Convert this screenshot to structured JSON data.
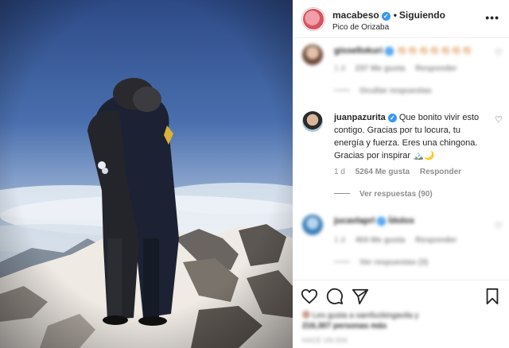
{
  "post": {
    "username": "macabeso",
    "follow_separator": "•",
    "follow_status": "Siguiendo",
    "location": "Pico de Orizaba",
    "more_icon": "ellipsis-icon"
  },
  "comments": [
    {
      "username": "gissellokuri",
      "text": "👏🏻👏🏻👏🏻👏🏻👏🏻👏🏻👏🏻",
      "time": "1 d",
      "likes": "237 Me gusta",
      "reply": "Responder",
      "replies_label": "Ocultar respuestas",
      "blurred": true
    },
    {
      "username": "juanpazurita",
      "text": "Que bonito vivir esto contigo. Gracias por tu locura, tu energía y fuerza. Eres una chingona. Gracias por inspirar 🏔️🌙",
      "time": "1 d",
      "likes": "5264 Me gusta",
      "reply": "Responder",
      "replies_label": "Ver respuestas (90)",
      "blurred": false
    },
    {
      "username": "jucavlaprl",
      "text": "Ídolos",
      "time": "1 d",
      "likes": "404 Me gusta",
      "reply": "Responder",
      "replies_label": "Ver respuestas (3)",
      "blurred": true
    }
  ],
  "actions": {
    "like_icon": "heart-icon",
    "comment_icon": "comment-icon",
    "share_icon": "send-icon",
    "save_icon": "bookmark-icon"
  },
  "likes_summary": {
    "line1": "Les gusta a samfuckingavila y",
    "line2": "216,307 personas más"
  },
  "timestamp": "HACE UN DÍA",
  "colors": {
    "verified": "#3897f0",
    "secondary_text": "#8e8e8e",
    "primary_text": "#262626"
  }
}
